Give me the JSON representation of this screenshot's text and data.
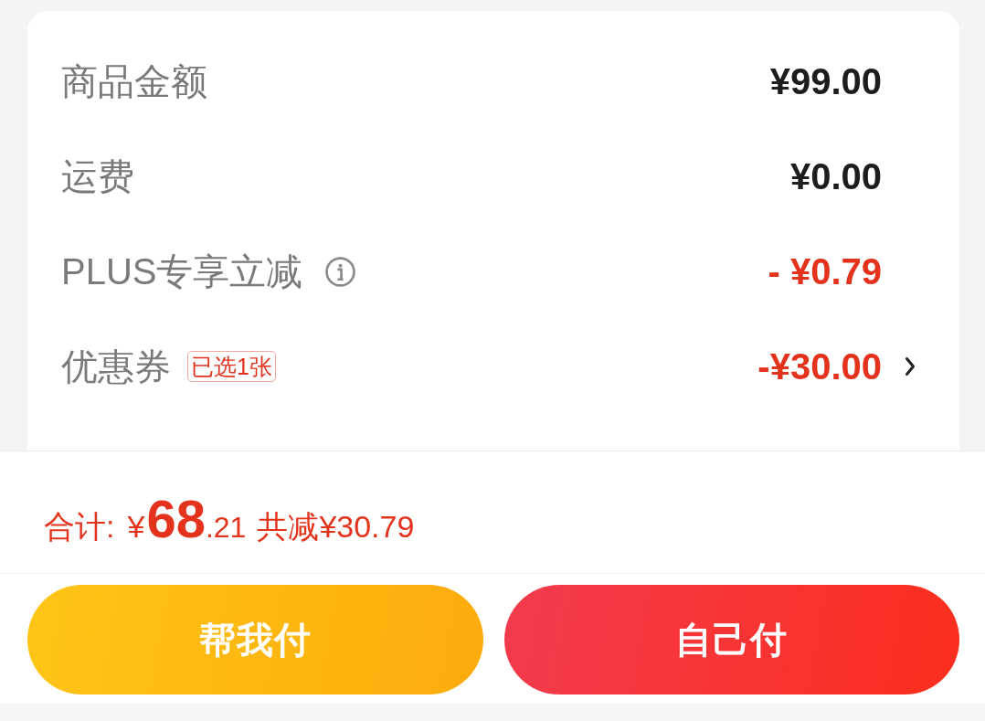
{
  "summary_rows": [
    {
      "kind": "amount",
      "label": "商品金额",
      "value": "¥99.00"
    },
    {
      "kind": "amount",
      "label": "运费",
      "value": "¥0.00"
    },
    {
      "kind": "member_discount",
      "label": "PLUS专享立减",
      "value": "- ¥0.79"
    },
    {
      "kind": "coupon",
      "label": "优惠券",
      "tag": "已选1张",
      "value": "-¥30.00"
    }
  ],
  "total": {
    "label": "合计:",
    "currency": "¥",
    "integer": "68",
    "decimal": ".21",
    "discount": "共减¥30.79"
  },
  "buttons": [
    {
      "kind": "secondary",
      "label": "帮我付"
    },
    {
      "kind": "primary",
      "label": "自己付"
    }
  ]
}
